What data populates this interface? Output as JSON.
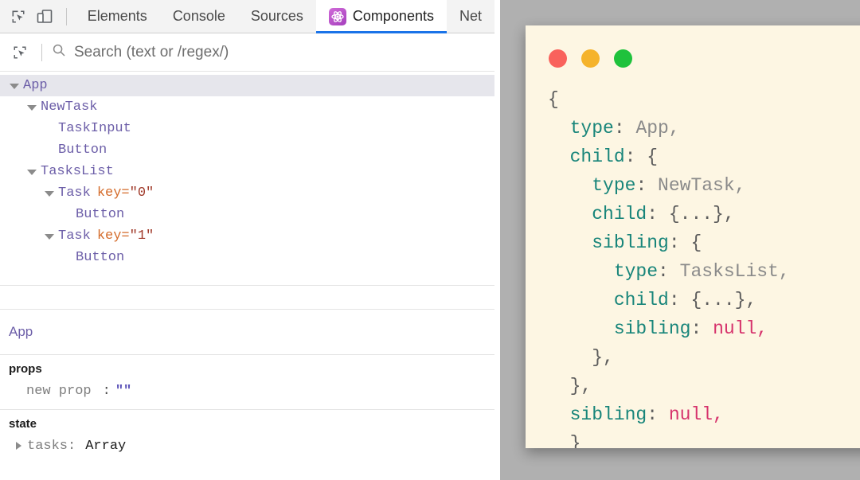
{
  "devtools": {
    "toolbar": {
      "inspect_icon": "inspect-cursor-icon",
      "device_icon": "device-toolbar-icon",
      "tabs": [
        {
          "label": "Elements",
          "active": false,
          "icon": null
        },
        {
          "label": "Console",
          "active": false,
          "icon": null
        },
        {
          "label": "Sources",
          "active": false,
          "icon": null
        },
        {
          "label": "Components",
          "active": true,
          "icon": "react-components-icon"
        },
        {
          "label": "Net",
          "active": false,
          "icon": null
        }
      ]
    },
    "search": {
      "select_icon": "select-element-icon",
      "search_icon": "search-icon",
      "placeholder": "Search (text or /regex/)",
      "value": ""
    },
    "tree": [
      {
        "depth": 0,
        "arrow": "open",
        "name": "App",
        "selected": true,
        "key_attr": null,
        "key_value": null
      },
      {
        "depth": 1,
        "arrow": "open",
        "name": "NewTask",
        "selected": false,
        "key_attr": null,
        "key_value": null
      },
      {
        "depth": 2,
        "arrow": "none",
        "name": "TaskInput",
        "selected": false,
        "key_attr": null,
        "key_value": null
      },
      {
        "depth": 2,
        "arrow": "none",
        "name": "Button",
        "selected": false,
        "key_attr": null,
        "key_value": null
      },
      {
        "depth": 1,
        "arrow": "open",
        "name": "TasksList",
        "selected": false,
        "key_attr": null,
        "key_value": null
      },
      {
        "depth": 2,
        "arrow": "open",
        "name": "Task",
        "selected": false,
        "key_attr": "key=",
        "key_value": "\"0\""
      },
      {
        "depth": 3,
        "arrow": "none",
        "name": "Button",
        "selected": false,
        "key_attr": null,
        "key_value": null
      },
      {
        "depth": 2,
        "arrow": "open",
        "name": "Task",
        "selected": false,
        "key_attr": "key=",
        "key_value": "\"1\""
      },
      {
        "depth": 3,
        "arrow": "none",
        "name": "Button",
        "selected": false,
        "key_attr": null,
        "key_value": null
      }
    ],
    "inspector": {
      "selected_component": "App",
      "props": {
        "title": "props",
        "name": "new prop",
        "colon": ":",
        "value": "\"\""
      },
      "state": {
        "title": "state",
        "name": "tasks:",
        "value": "Array"
      }
    }
  },
  "code_card": {
    "dots": [
      {
        "name": "close-dot",
        "color": "#f9625c"
      },
      {
        "name": "minimize-dot",
        "color": "#f5b32b"
      },
      {
        "name": "maximize-dot",
        "color": "#1fc23c"
      }
    ],
    "lines": [
      {
        "indent": 0,
        "key": "",
        "value": "{",
        "kind": "punct"
      },
      {
        "indent": 1,
        "key": "type",
        "value": "App,",
        "kind": "value"
      },
      {
        "indent": 1,
        "key": "child",
        "value": "{",
        "kind": "punct"
      },
      {
        "indent": 2,
        "key": "type",
        "value": "NewTask,",
        "kind": "value"
      },
      {
        "indent": 2,
        "key": "child",
        "value": "{...},",
        "kind": "punct"
      },
      {
        "indent": 2,
        "key": "sibling",
        "value": "{",
        "kind": "punct"
      },
      {
        "indent": 3,
        "key": "type",
        "value": "TasksList,",
        "kind": "value"
      },
      {
        "indent": 3,
        "key": "child",
        "value": "{...},",
        "kind": "punct"
      },
      {
        "indent": 3,
        "key": "sibling",
        "value": "null,",
        "kind": "null"
      },
      {
        "indent": 2,
        "key": "",
        "value": "},",
        "kind": "punct"
      },
      {
        "indent": 1,
        "key": "",
        "value": "},",
        "kind": "punct"
      },
      {
        "indent": 1,
        "key": "sibling",
        "value": "null,",
        "kind": "null"
      },
      {
        "indent": 0,
        "key": "",
        "value": "}",
        "kind": "punct"
      }
    ]
  }
}
